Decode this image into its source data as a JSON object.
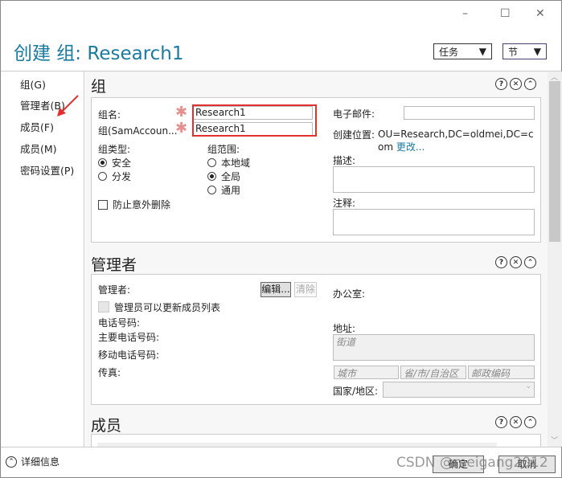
{
  "window": {
    "minimize": "–",
    "maximize": "☐",
    "close": "✕"
  },
  "header": {
    "title": "创建 组: Research1",
    "tasks": "任务",
    "sections": "节"
  },
  "sidebar": {
    "items": [
      {
        "label": "组(G)"
      },
      {
        "label": "管理者(B)"
      },
      {
        "label": "成员(F)"
      },
      {
        "label": "成员(M)"
      },
      {
        "label": "密码设置(P)"
      }
    ]
  },
  "group": {
    "title": "组",
    "name_label": "组名:",
    "name_value": "Research1",
    "sam_label": "组(SamAccoun...",
    "sam_value": "Research1",
    "type_label": "组类型:",
    "type_options": [
      "安全",
      "分发"
    ],
    "scope_label": "组范围:",
    "scope_options": [
      "本地域",
      "全局",
      "通用"
    ],
    "protect_label": "防止意外删除",
    "email_label": "电子邮件:",
    "location_label": "创建位置:",
    "location_value": "OU=Research,DC=oldmei,DC=com",
    "change_link": "更改...",
    "desc_label": "描述:",
    "notes_label": "注释:"
  },
  "managed": {
    "title": "管理者",
    "manager_label": "管理者:",
    "edit": "编辑...",
    "clear": "清除",
    "can_update": "管理员可以更新成员列表",
    "phone": "电话号码:",
    "main_phone": "主要电话号码:",
    "mobile": "移动电话号码:",
    "fax": "传真:",
    "office": "办公室:",
    "address": "地址:",
    "street_ph": "街道",
    "city_ph": "城市",
    "state_ph": "省/市/自治区",
    "zip_ph": "邮政编码",
    "country": "国家/地区:"
  },
  "members": {
    "title": "成员"
  },
  "icons": {
    "help": "?",
    "close": "✕",
    "collapse": "⌃"
  },
  "footer": {
    "details": "详细信息",
    "ok": "确定",
    "cancel": "取消",
    "watermark": "CSDN @meigang2012"
  }
}
